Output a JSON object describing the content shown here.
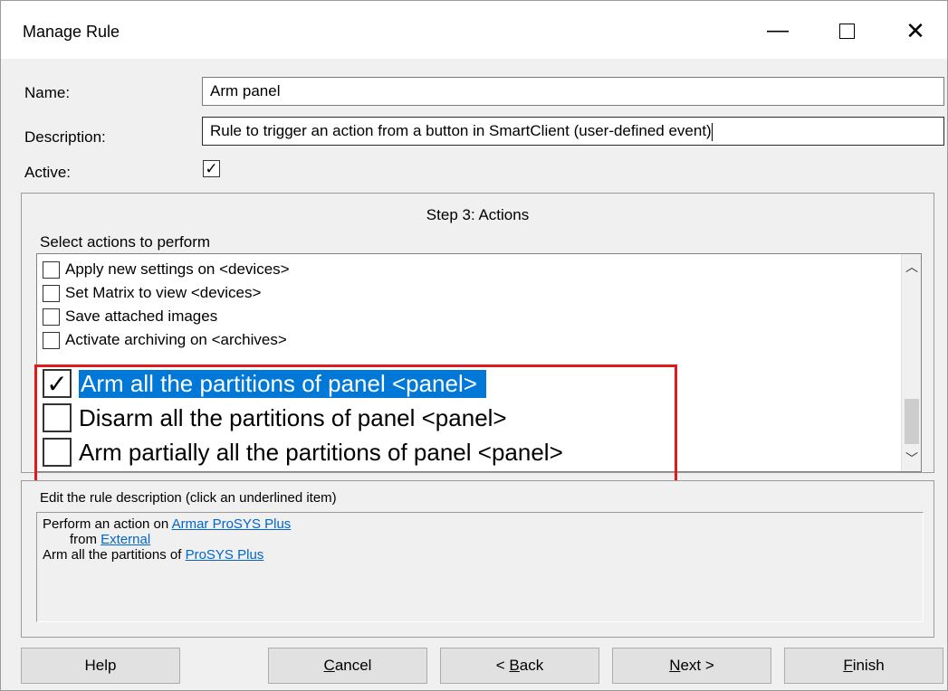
{
  "window": {
    "title": "Manage Rule",
    "controls": {
      "minimize": "—",
      "close": "✕"
    }
  },
  "form": {
    "name_label": "Name:",
    "name_value": "Arm panel",
    "description_label": "Description:",
    "description_value": "Rule to trigger an action from a button in SmartClient (user-defined event)",
    "active_label": "Active:",
    "active_checked": true
  },
  "step": {
    "title": "Step 3: Actions",
    "select_label": "Select actions to perform",
    "actions": [
      {
        "label": "Apply new settings on <devices>",
        "checked": false
      },
      {
        "label": "Set Matrix to view <devices>",
        "checked": false
      },
      {
        "label": "Save attached images",
        "checked": false
      },
      {
        "label": "Activate archiving on <archives>",
        "checked": false
      },
      {
        "label": "Arm all the partitions of panel <panel>",
        "checked": true,
        "selected": true
      },
      {
        "label": "Disarm all the partitions of panel <panel>",
        "checked": false
      },
      {
        "label": "Arm partially all the partitions of panel <panel>",
        "checked": false
      }
    ]
  },
  "rule_description": {
    "label": "Edit the rule description (click an underlined item)",
    "line1_text": "Perform an action on ",
    "line1_link": "Armar ProSYS Plus",
    "line2_text": "from ",
    "line2_link": "External",
    "line3_text": "Arm all the partitions of ",
    "line3_link": "ProSYS Plus"
  },
  "buttons": {
    "help": "Help",
    "cancel_u": "C",
    "cancel_rest": "ancel",
    "back_pre": "< ",
    "back_u": "B",
    "back_rest": "ack",
    "next_u": "N",
    "next_rest": "ext >",
    "finish_u": "F",
    "finish_rest": "inish"
  },
  "colors": {
    "selection": "#0078d7",
    "highlight_box": "#e0191c",
    "link": "#0066cc"
  }
}
